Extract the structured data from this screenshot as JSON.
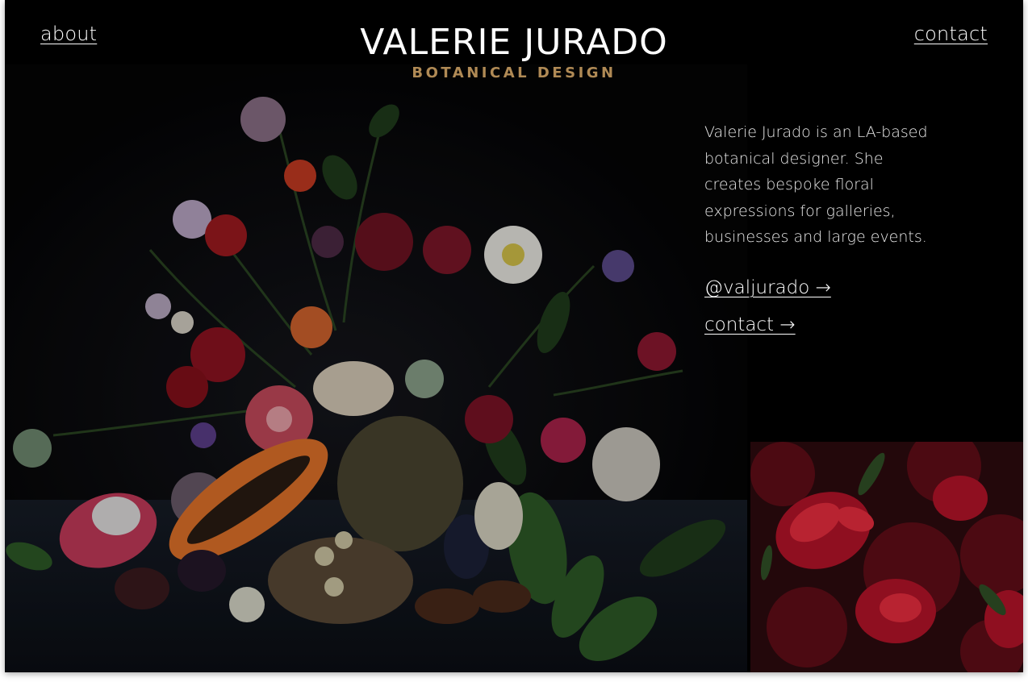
{
  "nav": {
    "about_label": "about",
    "contact_label": "contact"
  },
  "brand": {
    "name": "VALERIE JURADO",
    "tagline": "BOTANICAL DESIGN"
  },
  "intro": {
    "text": "Valerie Jurado is an LA-based botanical designer. She creates bespoke floral expressions for galleries, businesses and large events."
  },
  "links": {
    "instagram_label": "@valjurado →",
    "contact_label": "contact →"
  },
  "colors": {
    "background": "#000000",
    "tagline_gold": "#b08a55",
    "text": "#ffffff"
  },
  "images": {
    "main": "floral-still-life-arrangement",
    "side": "red-flowers-closeup"
  }
}
